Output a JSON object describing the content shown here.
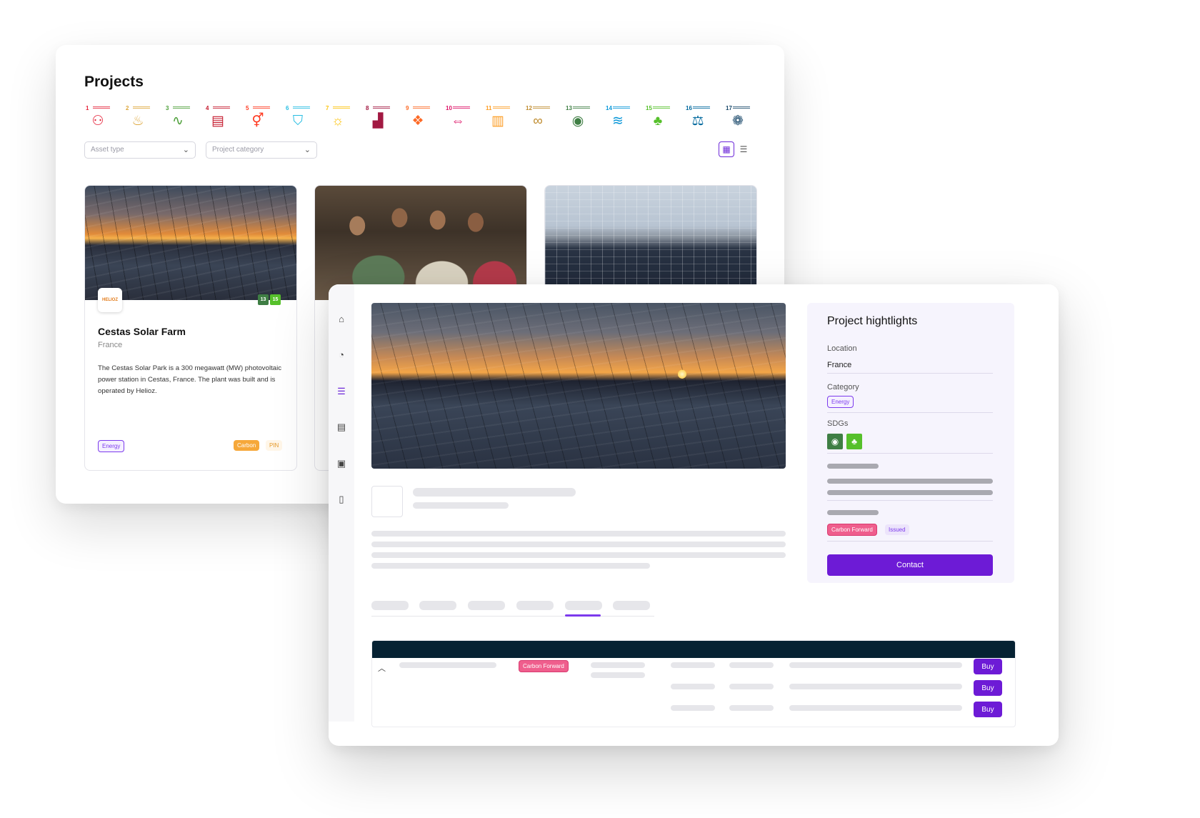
{
  "projects_page": {
    "title": "Projects",
    "sdgs": [
      {
        "num": "1",
        "color": "#e5243b",
        "glyph": "⚇"
      },
      {
        "num": "2",
        "color": "#dda63a",
        "glyph": "♨"
      },
      {
        "num": "3",
        "color": "#4c9f38",
        "glyph": "∿"
      },
      {
        "num": "4",
        "color": "#c5192d",
        "glyph": "▤"
      },
      {
        "num": "5",
        "color": "#ff3a21",
        "glyph": "⚥"
      },
      {
        "num": "6",
        "color": "#26bde2",
        "glyph": "⛉"
      },
      {
        "num": "7",
        "color": "#fcc30b",
        "glyph": "☼"
      },
      {
        "num": "8",
        "color": "#a21942",
        "glyph": "▟"
      },
      {
        "num": "9",
        "color": "#fd6925",
        "glyph": "❖"
      },
      {
        "num": "10",
        "color": "#dd1367",
        "glyph": "⇔"
      },
      {
        "num": "11",
        "color": "#fd9d24",
        "glyph": "▥"
      },
      {
        "num": "12",
        "color": "#bf8b2e",
        "glyph": "∞"
      },
      {
        "num": "13",
        "color": "#3f7e44",
        "glyph": "◉"
      },
      {
        "num": "14",
        "color": "#0a97d9",
        "glyph": "≋"
      },
      {
        "num": "15",
        "color": "#56c02b",
        "glyph": "♣"
      },
      {
        "num": "16",
        "color": "#00689d",
        "glyph": "⚖"
      },
      {
        "num": "17",
        "color": "#19486a",
        "glyph": "❁"
      }
    ],
    "filters": {
      "asset_type_placeholder": "Asset type",
      "project_category_placeholder": "Project category"
    },
    "card": {
      "logo_text": "HELIOZ",
      "sdg_badges": [
        {
          "num": "13",
          "color": "#3f7e44"
        },
        {
          "num": "15",
          "color": "#56c02b"
        }
      ],
      "title": "Cestas Solar Farm",
      "location": "France",
      "description": "The Cestas Solar Park is a 300 megawatt (MW) photovoltaic power station in Cestas, France. The plant was built and is operated by Helioz.",
      "category_tag": "Energy",
      "asset_tags": [
        "Carbon",
        "PIN"
      ]
    }
  },
  "project_detail": {
    "highlights": {
      "title": "Project hightlights",
      "location_label": "Location",
      "location_value": "France",
      "category_label": "Category",
      "category_tag": "Energy",
      "sdgs_label": "SDGs",
      "sdg_badges": [
        {
          "num": "13",
          "color": "#3f7e44",
          "glyph": "◉"
        },
        {
          "num": "15",
          "color": "#56c02b",
          "glyph": "♣"
        }
      ],
      "status_tags": [
        "Carbon Forward",
        "Issued"
      ],
      "contact_label": "Contact"
    },
    "table": {
      "row_tag": "Carbon Forward",
      "buy_labels": [
        "Buy",
        "Buy",
        "Buy"
      ]
    }
  }
}
